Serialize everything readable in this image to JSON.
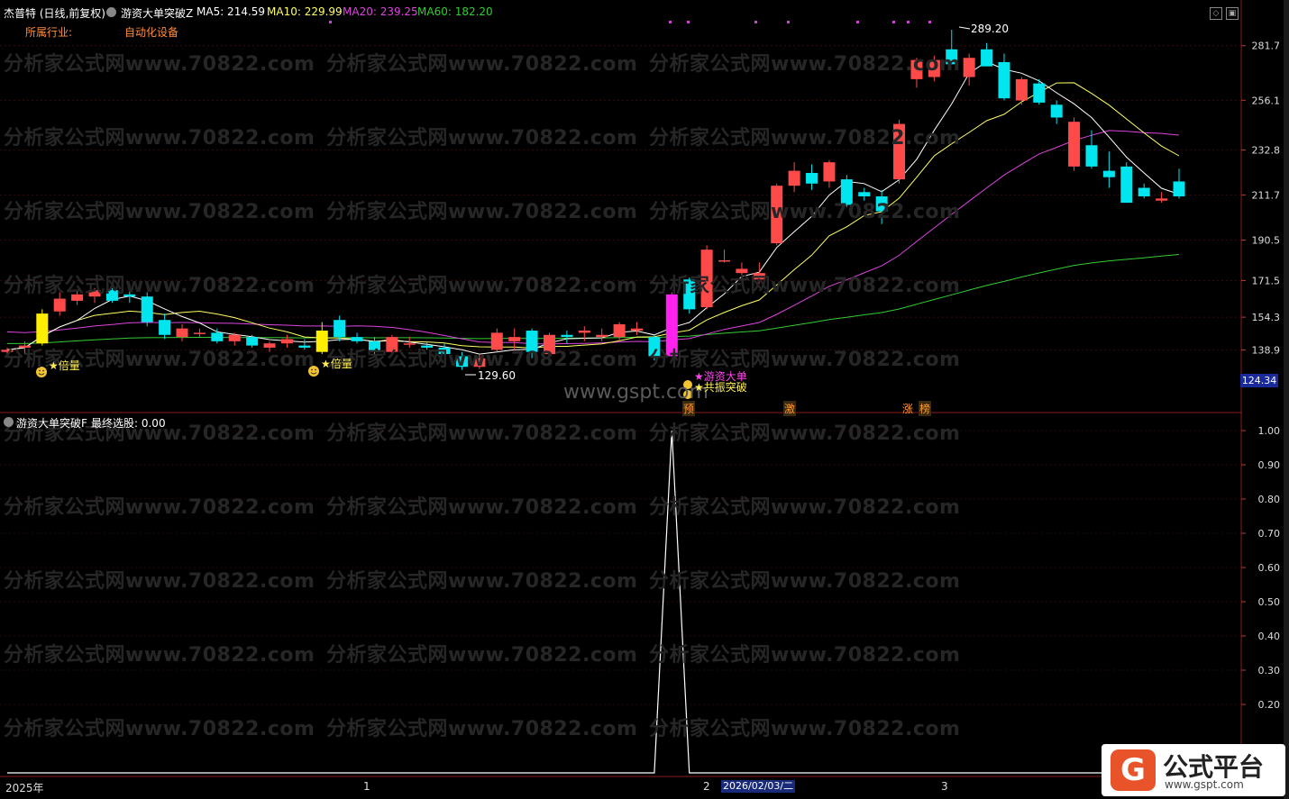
{
  "header": {
    "stock_title": "杰普特 (日线,前复权)",
    "indicator_name": "游资大单突破Z",
    "ma5": "MA5: 214.59",
    "ma10": "MA10: 229.99",
    "ma20": "MA20: 239.25",
    "ma60": "MA60: 182.20",
    "industry_label": "所属行业:",
    "industry_value": "自动化设备"
  },
  "lower_header": {
    "indicator_name": "游资大单突破F",
    "value_text": "最终选股: 0.00"
  },
  "annotations": {
    "high_label": "289.20",
    "low_label": "129.60",
    "beiliang_1": "★倍量",
    "beiliang_2": "★倍量",
    "signal_1": "★游资大单",
    "signal_2": "★共振突破",
    "marker_yu": "预",
    "marker_ji": "激",
    "marker_zhang": "涨",
    "marker_bang": "榜",
    "current_price": "124.34"
  },
  "x_axis": {
    "labels": [
      "2025年",
      "1",
      "2",
      "2026/02/03/二",
      "3"
    ]
  },
  "watermark": {
    "text": "分析家公式网www.70822.com",
    "site": "www.gspt.com"
  },
  "logo": {
    "glyph": "G",
    "title": "公式平台",
    "url": "www.gspt.com"
  },
  "colors": {
    "up": "#ff4a4a",
    "down": "#00e5ee",
    "ma5": "#ffffff",
    "ma10": "#ffff66",
    "ma20": "#dd44dd",
    "ma60": "#33cc33",
    "signal_bar": "#ff22ee",
    "beiliang_bar": "#ffee00"
  },
  "chart_data": [
    {
      "type": "candlestick",
      "title": "杰普特 (日线,前复权)",
      "ylim": [
        124.34,
        300
      ],
      "y_ticks": [
        281.7,
        256.1,
        232.8,
        211.7,
        190.5,
        171.5,
        154.3,
        138.9
      ],
      "candles": [
        {
          "o": 138,
          "h": 140,
          "l": 136,
          "c": 139
        },
        {
          "o": 140,
          "h": 143,
          "l": 137,
          "c": 141
        },
        {
          "o": 142,
          "h": 158,
          "l": 141,
          "c": 156,
          "tag": "beiliang"
        },
        {
          "o": 157,
          "h": 166,
          "l": 155,
          "c": 163
        },
        {
          "o": 162,
          "h": 167,
          "l": 160,
          "c": 165
        },
        {
          "o": 164,
          "h": 168,
          "l": 161,
          "c": 167
        },
        {
          "o": 167,
          "h": 168,
          "l": 161,
          "c": 162
        },
        {
          "o": 165,
          "h": 168,
          "l": 161,
          "c": 164
        },
        {
          "o": 164,
          "h": 166,
          "l": 150,
          "c": 152
        },
        {
          "o": 153,
          "h": 156,
          "l": 144,
          "c": 146
        },
        {
          "o": 145,
          "h": 151,
          "l": 143,
          "c": 149
        },
        {
          "o": 147,
          "h": 149,
          "l": 145,
          "c": 147
        },
        {
          "o": 147,
          "h": 149,
          "l": 142,
          "c": 143
        },
        {
          "o": 143,
          "h": 147,
          "l": 141,
          "c": 146
        },
        {
          "o": 145,
          "h": 146,
          "l": 140,
          "c": 141
        },
        {
          "o": 140,
          "h": 143,
          "l": 138,
          "c": 142
        },
        {
          "o": 142,
          "h": 146,
          "l": 140,
          "c": 144
        },
        {
          "o": 141,
          "h": 144,
          "l": 139,
          "c": 140
        },
        {
          "o": 138,
          "h": 152,
          "l": 137,
          "c": 148,
          "tag": "beiliang"
        },
        {
          "o": 153,
          "h": 155,
          "l": 143,
          "c": 145
        },
        {
          "o": 145,
          "h": 147,
          "l": 142,
          "c": 143
        },
        {
          "o": 143,
          "h": 145,
          "l": 137,
          "c": 138
        },
        {
          "o": 138,
          "h": 146,
          "l": 137,
          "c": 145
        },
        {
          "o": 142,
          "h": 145,
          "l": 140,
          "c": 142
        },
        {
          "o": 141,
          "h": 143,
          "l": 139,
          "c": 140
        },
        {
          "o": 140,
          "h": 142,
          "l": 136,
          "c": 137
        },
        {
          "o": 136,
          "h": 138,
          "l": 129.6,
          "c": 131
        },
        {
          "o": 131,
          "h": 137,
          "l": 130,
          "c": 135
        },
        {
          "o": 139,
          "h": 149,
          "l": 138,
          "c": 147
        },
        {
          "o": 143,
          "h": 149,
          "l": 139,
          "c": 145
        },
        {
          "o": 148,
          "h": 149,
          "l": 135,
          "c": 138
        },
        {
          "o": 137,
          "h": 147,
          "l": 136,
          "c": 146
        },
        {
          "o": 146,
          "h": 148,
          "l": 142,
          "c": 145
        },
        {
          "o": 147,
          "h": 150,
          "l": 143,
          "c": 148
        },
        {
          "o": 145,
          "h": 149,
          "l": 143,
          "c": 146
        },
        {
          "o": 145,
          "h": 152,
          "l": 143,
          "c": 151
        },
        {
          "o": 148,
          "h": 152,
          "l": 146,
          "c": 149
        },
        {
          "o": 145,
          "h": 146,
          "l": 134,
          "c": 136
        },
        {
          "o": 136,
          "h": 166,
          "l": 136,
          "c": 165,
          "tag": "signal"
        },
        {
          "o": 172,
          "h": 173,
          "l": 156,
          "c": 158
        },
        {
          "o": 159,
          "h": 188,
          "l": 158,
          "c": 186
        },
        {
          "o": 181,
          "h": 186,
          "l": 180,
          "c": 181
        },
        {
          "o": 175,
          "h": 180,
          "l": 172,
          "c": 177
        },
        {
          "o": 172,
          "h": 180,
          "l": 170,
          "c": 175
        },
        {
          "o": 189,
          "h": 217,
          "l": 188,
          "c": 216
        },
        {
          "o": 216,
          "h": 227,
          "l": 213,
          "c": 223
        },
        {
          "o": 222,
          "h": 226,
          "l": 214,
          "c": 217
        },
        {
          "o": 218,
          "h": 228,
          "l": 215,
          "c": 227
        },
        {
          "o": 219,
          "h": 221,
          "l": 206,
          "c": 207
        },
        {
          "o": 213,
          "h": 215,
          "l": 209,
          "c": 211
        },
        {
          "o": 211,
          "h": 214,
          "l": 198,
          "c": 204
        },
        {
          "o": 219,
          "h": 247,
          "l": 217,
          "c": 245
        },
        {
          "o": 266,
          "h": 276,
          "l": 262,
          "c": 275
        },
        {
          "o": 267,
          "h": 277,
          "l": 265,
          "c": 275
        },
        {
          "o": 280,
          "h": 289.2,
          "l": 273,
          "c": 273
        },
        {
          "o": 267,
          "h": 278,
          "l": 263,
          "c": 276
        },
        {
          "o": 280,
          "h": 283,
          "l": 272,
          "c": 272
        },
        {
          "o": 274,
          "h": 278,
          "l": 256,
          "c": 257
        },
        {
          "o": 256,
          "h": 267,
          "l": 254,
          "c": 266
        },
        {
          "o": 264,
          "h": 266,
          "l": 254,
          "c": 255
        },
        {
          "o": 254,
          "h": 256,
          "l": 245,
          "c": 248
        },
        {
          "o": 225,
          "h": 248,
          "l": 223,
          "c": 246
        },
        {
          "o": 235,
          "h": 242,
          "l": 224,
          "c": 225
        },
        {
          "o": 223,
          "h": 232,
          "l": 215,
          "c": 220
        },
        {
          "o": 225,
          "h": 227,
          "l": 208,
          "c": 208
        },
        {
          "o": 215,
          "h": 217,
          "l": 210,
          "c": 211
        },
        {
          "o": 209,
          "h": 213,
          "l": 208,
          "c": 210
        },
        {
          "o": 218,
          "h": 224,
          "l": 210,
          "c": 211
        }
      ]
    },
    {
      "type": "line",
      "title": "游资大单突破F",
      "ylim": [
        0,
        1.05
      ],
      "y_ticks": [
        1.0,
        0.9,
        0.8,
        0.7,
        0.6,
        0.5,
        0.4,
        0.3,
        0.2
      ],
      "series": [
        {
          "values_nonzero_index": 38,
          "peak": 1.0,
          "else": 0.0
        }
      ]
    }
  ]
}
